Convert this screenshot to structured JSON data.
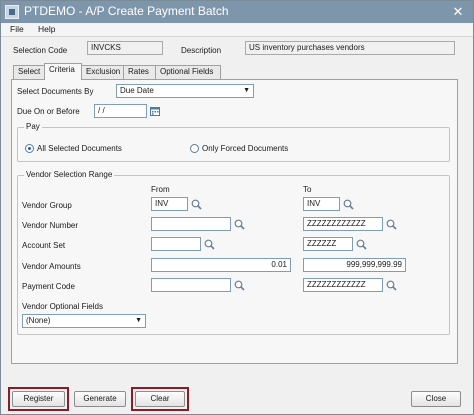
{
  "window": {
    "title": "PTDEMO - A/P Create Payment Batch",
    "close_glyph": "✕"
  },
  "menu": {
    "file": "File",
    "help": "Help"
  },
  "header": {
    "selection_code_label": "Selection Code",
    "selection_code_value": "INVCKS",
    "description_label": "Description",
    "description_value": "US inventory purchases vendors"
  },
  "tabs": [
    "Select",
    "Criteria",
    "Exclusion",
    "Rates",
    "Optional Fields"
  ],
  "active_tab": "Criteria",
  "criteria": {
    "select_documents_by_label": "Select Documents By",
    "select_documents_by_value": "Due Date",
    "due_on_or_before_label": "Due On or Before",
    "due_on_or_before_value": "/ /",
    "pay_group_title": "Pay",
    "pay_options": [
      {
        "label": "All Selected Documents",
        "selected": true
      },
      {
        "label": "Only Forced Documents",
        "selected": false
      }
    ]
  },
  "vendor_range": {
    "title": "Vendor Selection Range",
    "from_label": "From",
    "to_label": "To",
    "rows": [
      {
        "label": "Vendor Group",
        "from": "INV",
        "to": "INV"
      },
      {
        "label": "Vendor Number",
        "from": "",
        "to": "ZZZZZZZZZZZZ"
      },
      {
        "label": "Account Set",
        "from": "",
        "to": "ZZZZZZ"
      },
      {
        "label": "Vendor Amounts",
        "from": "0.01",
        "to": "999,999,999.99"
      },
      {
        "label": "Payment Code",
        "from": "",
        "to": "ZZZZZZZZZZZZ"
      }
    ],
    "optional_fields_label": "Vendor Optional Fields",
    "optional_fields_value": "(None)"
  },
  "buttons": {
    "register": "Register",
    "generate": "Generate",
    "clear": "Clear",
    "close": "Close"
  },
  "colors": {
    "titlebar": "#7e96ab",
    "highlight": "#8b1c25"
  }
}
